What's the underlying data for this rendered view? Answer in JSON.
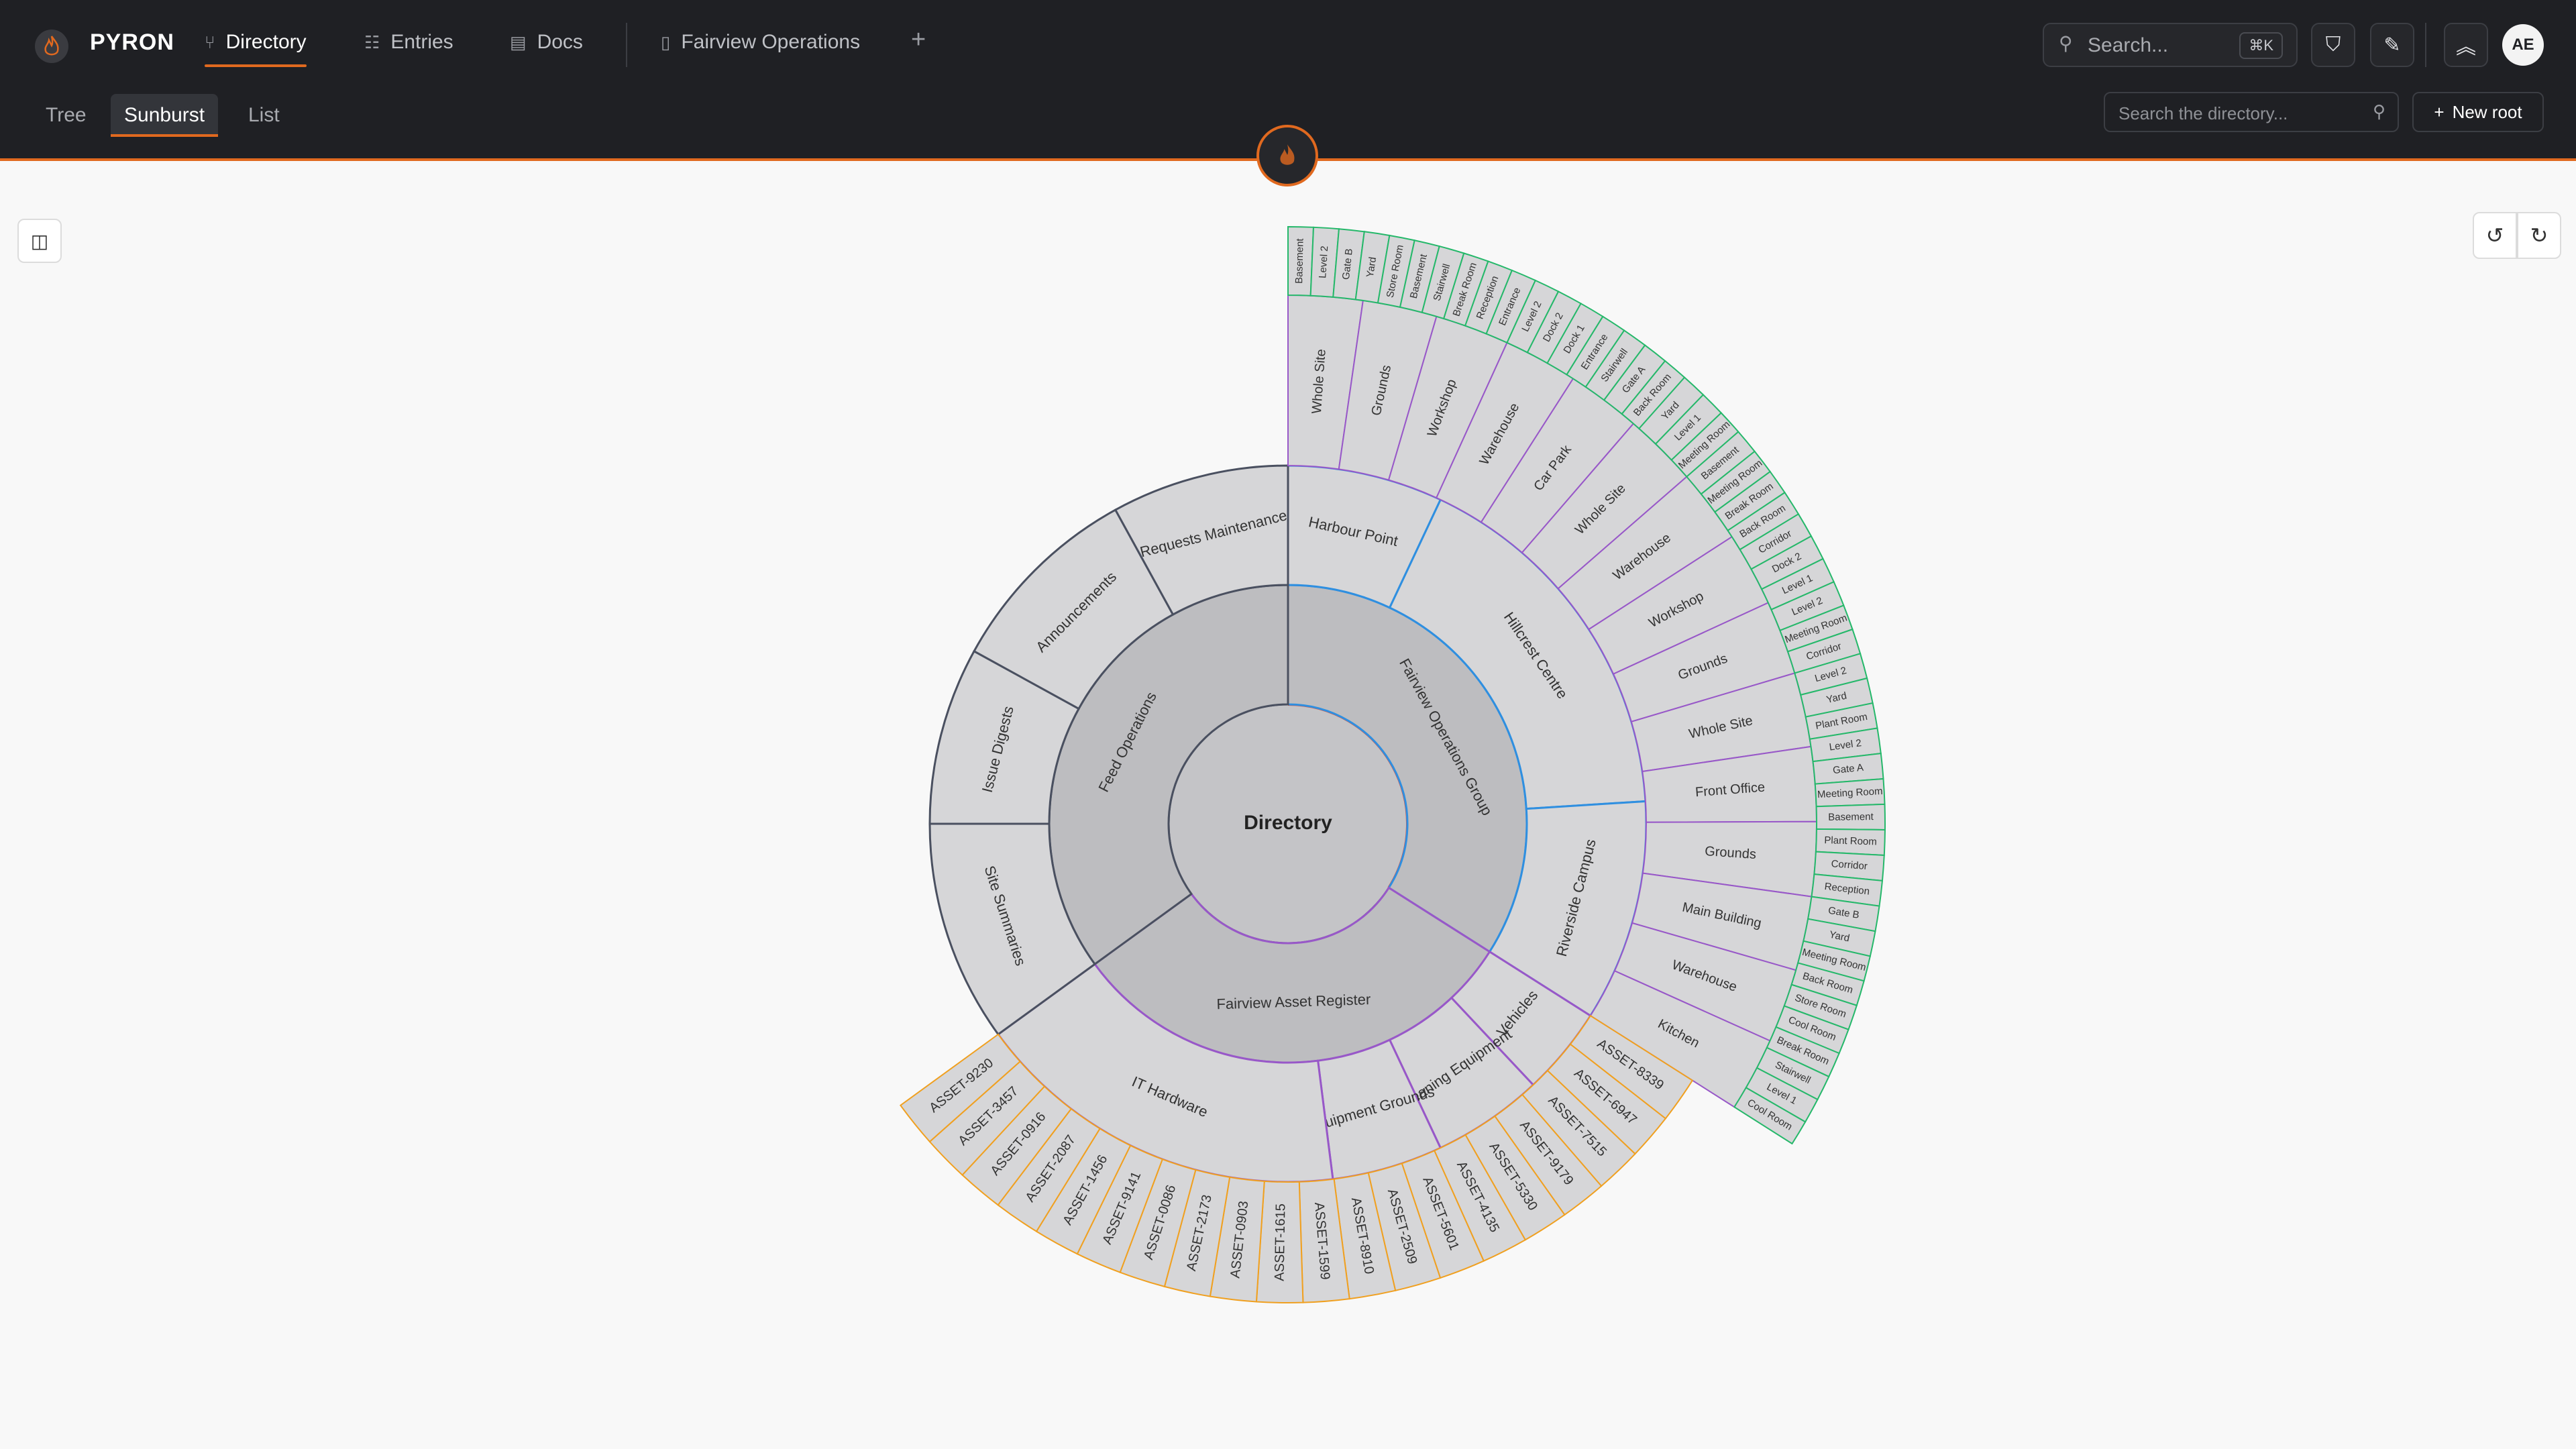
{
  "app": {
    "brand": "PYRON",
    "accent": "#e0691f"
  },
  "nav": {
    "tabs": [
      {
        "label": "Directory",
        "icon": "branch-icon",
        "active": true
      },
      {
        "label": "Entries",
        "icon": "list-icon",
        "active": false
      },
      {
        "label": "Docs",
        "icon": "book-icon",
        "active": false
      },
      {
        "label": "Fairview Operations",
        "icon": "file-icon",
        "active": false
      }
    ],
    "search_placeholder": "Search...",
    "shortcut": "⌘K",
    "avatar": "AE"
  },
  "view_tabs": [
    {
      "label": "Tree",
      "active": false
    },
    {
      "label": "Sunburst",
      "active": true
    },
    {
      "label": "List",
      "active": false
    }
  ],
  "directory_search_placeholder": "Search the directory...",
  "new_root_label": "New root",
  "sunburst": {
    "root_label": "Directory",
    "colors": {
      "fill_level1": "#bdbdc0",
      "fill_outer": "#d6d6d8",
      "root_fill": "#c4c4c7",
      "branch_operations": "#4a5060",
      "branch_assets": "#f0a020",
      "branch_fairview": "#25b86a",
      "branch_fairview_mid": "#9858c8",
      "branch_fairview_inner": "#2f8fe0",
      "root_arc_red": "#e0503a"
    },
    "level1": [
      {
        "label": "Fairview Operations Group",
        "from": 0,
        "to": 0.34
      },
      {
        "label": "Fairview Asset Register",
        "from": 0.34,
        "to": 0.65
      },
      {
        "label": "Feed Operations",
        "from": 0.65,
        "to": 1.0
      }
    ],
    "level2": [
      {
        "label": "Harbour Point",
        "from": 0,
        "to": 0.07
      },
      {
        "label": "Hillcrest Centre",
        "from": 0.07,
        "to": 0.24
      },
      {
        "label": "Riverside Campus",
        "from": 0.24,
        "to": 0.34
      },
      {
        "label": "Vehicles",
        "from": 0.34,
        "to": 0.38
      },
      {
        "label": "Cleaning Equipment",
        "from": 0.38,
        "to": 0.43
      },
      {
        "label": "Equipment Grounds",
        "from": 0.43,
        "to": 0.48
      },
      {
        "label": "IT Hardware",
        "from": 0.48,
        "to": 0.65
      },
      {
        "label": "Site Summaries",
        "from": 0.65,
        "to": 0.75
      },
      {
        "label": "Issue Digests",
        "from": 0.75,
        "to": 0.83
      },
      {
        "label": "Announcements",
        "from": 0.83,
        "to": 0.92
      },
      {
        "label": "Requests Maintenance",
        "from": 0.92,
        "to": 1.0
      }
    ],
    "level3_fairview": [
      "Whole Site",
      "Grounds",
      "Workshop",
      "Warehouse",
      "Car Park",
      "Whole Site",
      "Warehouse",
      "Workshop",
      "Grounds",
      "Whole Site",
      "Front Office",
      "Grounds",
      "Main Building",
      "Warehouse",
      "Kitchen"
    ],
    "level4_fairview": [
      "Basement",
      "Level 2",
      "Gate B",
      "Yard",
      "Store Room",
      "Basement",
      "Stairwell",
      "Break Room",
      "Reception",
      "Entrance",
      "Level 2",
      "Dock 2",
      "Dock 1",
      "Entrance",
      "Stairwell",
      "Gate A",
      "Back Room",
      "Yard",
      "Level 1",
      "Meeting Room",
      "Basement",
      "Meeting Room",
      "Break Room",
      "Back Room",
      "Corridor",
      "Dock 2",
      "Level 1",
      "Level 2",
      "Meeting Room",
      "Corridor",
      "Level 2",
      "Yard",
      "Plant Room",
      "Level 2",
      "Gate A",
      "Meeting Room",
      "Basement",
      "Plant Room",
      "Corridor",
      "Reception",
      "Gate B",
      "Yard",
      "Meeting Room",
      "Back Room",
      "Store Room",
      "Cool Room",
      "Break Room",
      "Stairwell",
      "Level 1",
      "Cool Room"
    ],
    "assets": [
      "ASSET-8339",
      "ASSET-6947",
      "ASSET-7515",
      "ASSET-9179",
      "ASSET-5330",
      "ASSET-4135",
      "ASSET-5601",
      "ASSET-2509",
      "ASSET-8910",
      "ASSET-1599",
      "ASSET-1615",
      "ASSET-0903",
      "ASSET-2173",
      "ASSET-0086",
      "ASSET-9141",
      "ASSET-1456",
      "ASSET-2087",
      "ASSET-0916",
      "ASSET-3457",
      "ASSET-9230"
    ]
  }
}
